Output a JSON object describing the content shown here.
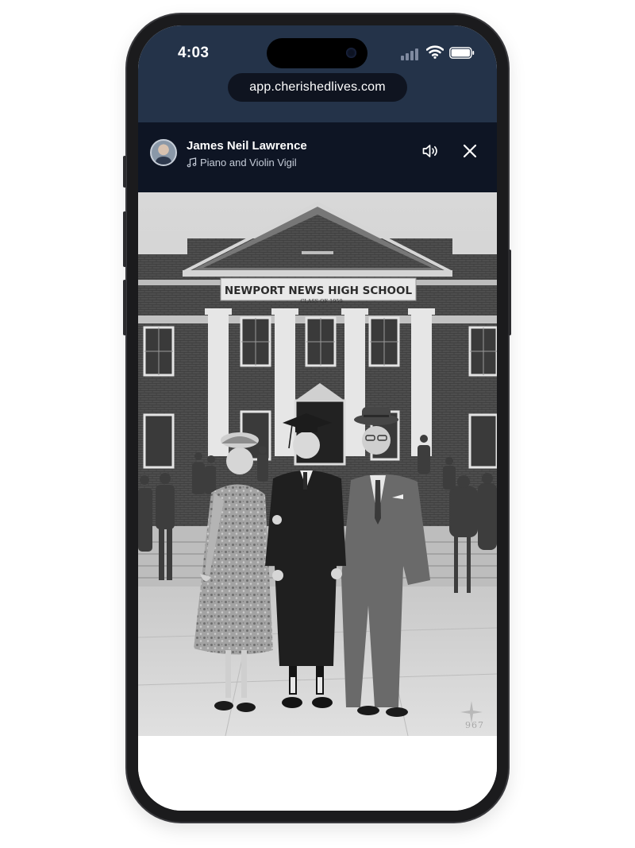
{
  "status_bar": {
    "time": "4:03"
  },
  "browser": {
    "url": "app.cherishedlives.com"
  },
  "player": {
    "name": "James Neil Lawrence",
    "track": "Piano and Violin Vigil",
    "track_icon": "music-note-icon",
    "sound_icon": "speaker-icon",
    "close_icon": "close-icon"
  },
  "photo": {
    "sign_text": "NEWPORT NEWS HIGH SCHOOL",
    "sign_subtext": "CLASS OF 1959",
    "watermark": "967"
  },
  "colors": {
    "browser_bar": "#243349",
    "player_bar": "#0e1524",
    "url_pill": "#0f1420"
  }
}
